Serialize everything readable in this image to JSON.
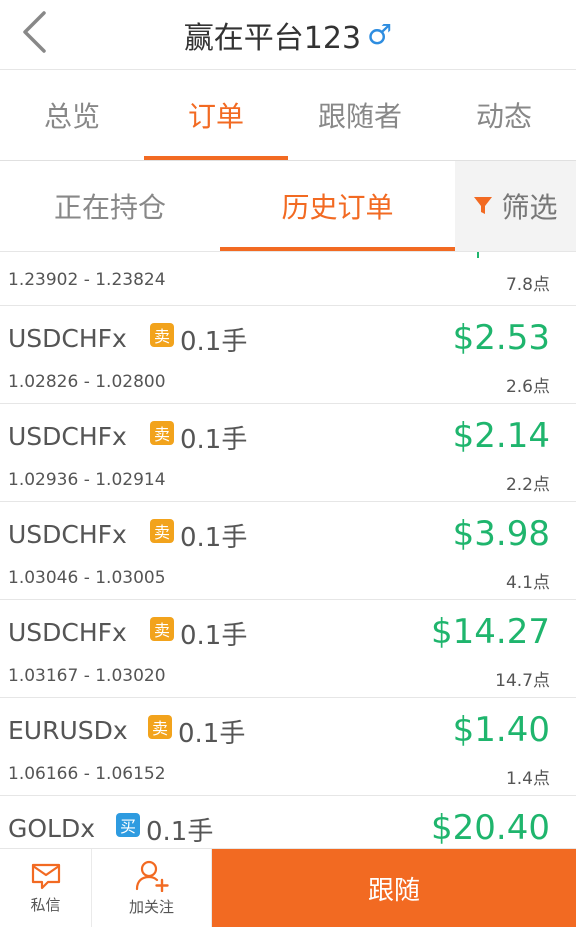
{
  "header": {
    "title": "赢在平台123",
    "gender_symbol": "♂"
  },
  "main_tabs": [
    {
      "label": "总览",
      "active": false
    },
    {
      "label": "订单",
      "active": true
    },
    {
      "label": "跟随者",
      "active": false
    },
    {
      "label": "动态",
      "active": false
    }
  ],
  "sub_tabs": [
    {
      "label": "正在持仓",
      "active": false
    },
    {
      "label": "历史订单",
      "active": true
    }
  ],
  "filter_label": "筛选",
  "partial_row": {
    "price_range": "1.23902 - 1.23824",
    "points": "7.8点"
  },
  "orders": [
    {
      "symbol": "USDCHFx",
      "side": "卖",
      "lots": "0.1手",
      "profit": "$2.53",
      "price_range": "1.02826 - 1.02800",
      "points": "2.6点"
    },
    {
      "symbol": "USDCHFx",
      "side": "卖",
      "lots": "0.1手",
      "profit": "$2.14",
      "price_range": "1.02936 - 1.02914",
      "points": "2.2点"
    },
    {
      "symbol": "USDCHFx",
      "side": "卖",
      "lots": "0.1手",
      "profit": "$3.98",
      "price_range": "1.03046 - 1.03005",
      "points": "4.1点"
    },
    {
      "symbol": "USDCHFx",
      "side": "卖",
      "lots": "0.1手",
      "profit": "$14.27",
      "price_range": "1.03167 - 1.03020",
      "points": "14.7点"
    },
    {
      "symbol": "EURUSDx",
      "side": "卖",
      "lots": "0.1手",
      "profit": "$1.40",
      "price_range": "1.06166 - 1.06152",
      "points": "1.4点"
    },
    {
      "symbol": "GOLDx",
      "side": "买",
      "lots": "0.1手",
      "profit": "$20.40",
      "price_range": "",
      "points": ""
    }
  ],
  "bottom_bar": {
    "message_label": "私信",
    "follow_user_label": "加关注",
    "follow_button_label": "跟随"
  },
  "colors": {
    "accent": "#f26a22",
    "profit_green": "#1fb56d",
    "sell_badge": "#f2a31c",
    "buy_badge": "#2e9be0",
    "gender_blue": "#2e8de0"
  }
}
